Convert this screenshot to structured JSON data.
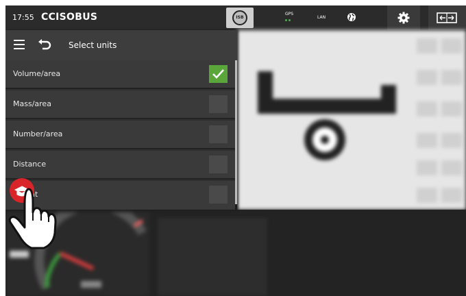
{
  "statusbar": {
    "time": "17:55",
    "brand": "CCISOBUS",
    "isb_label": "ISB",
    "gps_label": "GPS",
    "lan_label": "LAN"
  },
  "panel": {
    "title": "Select units",
    "items": [
      {
        "label": "Volume/area",
        "checked": true
      },
      {
        "label": "Mass/area",
        "checked": false
      },
      {
        "label": "Number/area",
        "checked": false
      },
      {
        "label": "Distance",
        "checked": false
      },
      {
        "label": "nt",
        "checked": false
      }
    ]
  },
  "colors": {
    "check_green": "#5aa63a",
    "gps_green": "#4caf50",
    "touch_red": "#d9252a"
  },
  "icons": [
    "hamburger-menu-icon",
    "back-arrow-icon",
    "isb-stop-icon",
    "globe-icon",
    "gear-icon",
    "swap-screen-icon",
    "checkmark-icon",
    "touch-hand-icon"
  ]
}
